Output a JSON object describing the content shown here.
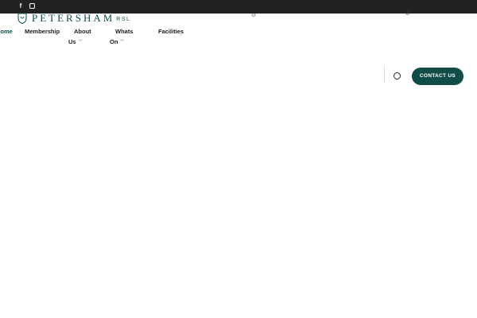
{
  "colors": {
    "topbar": "#222222",
    "brand": "#114d48",
    "text": "#1b1b1b",
    "background": "#ffffff"
  },
  "topbar": {
    "social": [
      {
        "name": "facebook",
        "icon": "facebook-icon",
        "glyph": "f"
      },
      {
        "name": "instagram",
        "icon": "instagram-icon"
      }
    ]
  },
  "logo": {
    "icon": "crest-icon",
    "text": "PETERSHAM",
    "suffix": "RSL"
  },
  "contact_icons": {
    "location": {
      "icon": "location-icon",
      "glyph": "⊙"
    },
    "phone": {
      "icon": "phone-icon",
      "glyph": "✆"
    }
  },
  "nav": {
    "home": "Home",
    "membership": "Membership",
    "about_line1": "About",
    "about_line2": "Us",
    "whats_line1": "Whats",
    "whats_line2": "On",
    "facilities": "Facilities",
    "chevron": "﹀"
  },
  "header_actions": {
    "search_icon": "search-icon",
    "contact_button": "CONTACT US"
  }
}
